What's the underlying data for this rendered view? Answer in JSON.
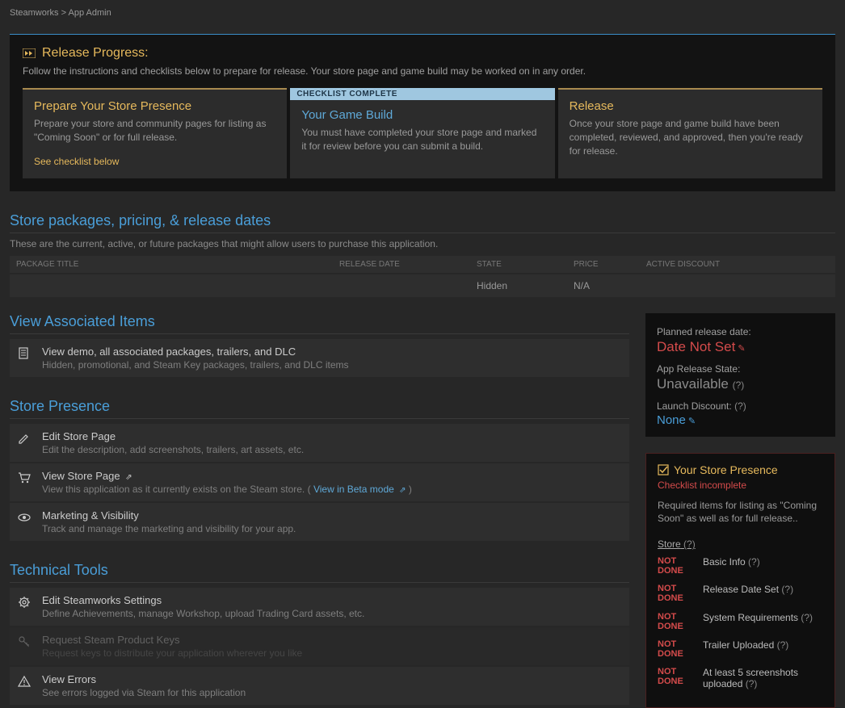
{
  "breadcrumbs": {
    "root": "Steamworks",
    "sep": ">",
    "current": "App Admin"
  },
  "releaseProgress": {
    "title": "Release Progress:",
    "desc": "Follow the instructions and checklists below to prepare for release. Your store page and game build may be worked on in any order.",
    "cards": [
      {
        "title": "Prepare Your Store Presence",
        "desc": "Prepare your store and community pages for listing as \"Coming Soon\" or for full release.",
        "link": "See checklist below"
      },
      {
        "badge": "CHECKLIST COMPLETE",
        "title": "Your Game Build",
        "desc": "You must have completed your store page and marked it for review before you can submit a build."
      },
      {
        "title": "Release",
        "desc": "Once your store page and game build have been completed, reviewed, and approved, then you're ready for release."
      }
    ]
  },
  "packages": {
    "title": "Store packages, pricing, & release dates",
    "subtitle": "These are the current, active, or future packages that might allow users to purchase this application.",
    "columns": {
      "title": "PACKAGE TITLE",
      "release": "RELEASE DATE",
      "state": "STATE",
      "price": "PRICE",
      "disc": "ACTIVE DISCOUNT"
    },
    "rows": [
      {
        "title": "",
        "release": "",
        "state": "Hidden",
        "price": "N/A",
        "disc": ""
      }
    ]
  },
  "associated": {
    "title": "View Associated Items",
    "item": {
      "title": "View demo, all associated packages, trailers, and DLC",
      "desc": "Hidden, promotional, and Steam Key packages, trailers, and DLC items"
    }
  },
  "storePresence": {
    "title": "Store Presence",
    "items": [
      {
        "title": "Edit Store Page",
        "desc": "Edit the description, add screenshots, trailers, art assets, etc."
      },
      {
        "titlePrefix": "View Store Page",
        "descPrefix": "View this application as it currently exists on the Steam store. (",
        "betaLink": "View in Beta mode",
        "descSuffix": ")"
      },
      {
        "title": "Marketing & Visibility",
        "desc": "Track and manage the marketing and visibility for your app."
      }
    ]
  },
  "technical": {
    "title": "Technical Tools",
    "items": [
      {
        "title": "Edit Steamworks Settings",
        "desc": "Define Achievements, manage Workshop, upload Trading Card assets, etc."
      },
      {
        "title": "Request Steam Product Keys",
        "desc": "Request keys to distribute your application wherever you like"
      },
      {
        "title": "View Errors",
        "desc": "See errors logged via Steam for this application"
      }
    ]
  },
  "sidebar": {
    "plannedLabel": "Planned release date:",
    "plannedValue": "Date Not Set",
    "stateLabel": "App Release State:",
    "stateValue": "Unavailable",
    "discountLabel": "Launch Discount:",
    "discountValue": "None",
    "q": "(?)"
  },
  "checklist": {
    "title": "Your Store Presence",
    "subtitle": "Checklist incomplete",
    "intro": "Required items for listing as \"Coming Soon\" as well as for full release..",
    "group": "Store",
    "notDone1": "NOT",
    "notDone2": "DONE",
    "items": [
      {
        "label": "Basic Info"
      },
      {
        "label": "Release Date Set"
      },
      {
        "label": "System Requirements"
      },
      {
        "label": "Trailer Uploaded"
      },
      {
        "label": "At least 5 screenshots uploaded"
      }
    ]
  }
}
